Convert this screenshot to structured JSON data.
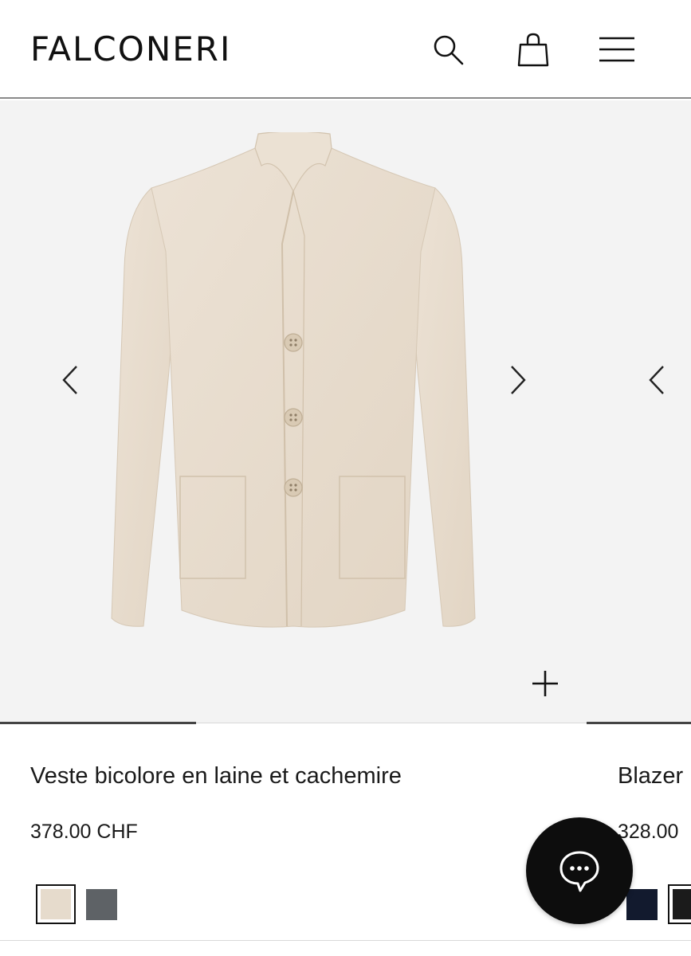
{
  "header": {
    "logo": "FALCONERI",
    "icons": [
      "search-icon",
      "shopping-bag-icon",
      "hamburger-menu-icon"
    ]
  },
  "carousel": {
    "main_product_image": "jacket",
    "controls": [
      "chevron-left-icon",
      "chevron-right-icon",
      "plus-icon"
    ]
  },
  "products": [
    {
      "name": "Veste bicolore en laine et cachemire",
      "price": "378.00 CHF",
      "swatches": [
        {
          "color": "#e6dbcc",
          "selected": true
        },
        {
          "color": "#5e6266",
          "selected": false
        }
      ]
    },
    {
      "name": "Blazer",
      "price": "328.00",
      "swatches": [
        {
          "color": "#121a2e",
          "selected": false
        },
        {
          "color": "#1b1b1b",
          "selected": true
        }
      ]
    }
  ],
  "chat": {
    "icon": "chat-bubble-icon"
  },
  "colors": {
    "accent": "#0d0d0d",
    "background": "#f3f3f3"
  }
}
